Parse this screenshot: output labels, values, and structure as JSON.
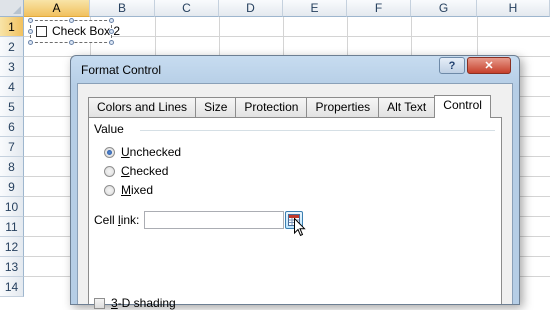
{
  "sheet": {
    "columns": [
      "A",
      "B",
      "C",
      "D",
      "E",
      "F",
      "G",
      "H"
    ],
    "selected_column": "A",
    "rows": [
      "1",
      "2",
      "3",
      "4",
      "5",
      "6",
      "7",
      "8",
      "9",
      "10",
      "11",
      "12",
      "13",
      "14"
    ],
    "selected_row": "1",
    "checkbox_label": "Check Box 2"
  },
  "dialog": {
    "title": "Format Control",
    "help_label": "?",
    "close_label": "✕",
    "tabs": [
      {
        "label": "Colors and Lines"
      },
      {
        "label": "Size"
      },
      {
        "label": "Protection"
      },
      {
        "label": "Properties"
      },
      {
        "label": "Alt Text"
      },
      {
        "label": "Control"
      }
    ],
    "active_tab": "Control",
    "value_section": "Value",
    "options": [
      {
        "label_ul": "U",
        "label_rest": "nchecked",
        "checked": true
      },
      {
        "label_ul": "C",
        "label_rest": "hecked",
        "checked": false
      },
      {
        "label_ul": "M",
        "label_rest": "ixed",
        "checked": false
      }
    ],
    "cell_link_label_pre": "Cell ",
    "cell_link_label_ul": "l",
    "cell_link_label_post": "ink:",
    "cell_link_value": "",
    "shading_ul": "3",
    "shading_rest": "-D shading",
    "shading_checked": false
  }
}
